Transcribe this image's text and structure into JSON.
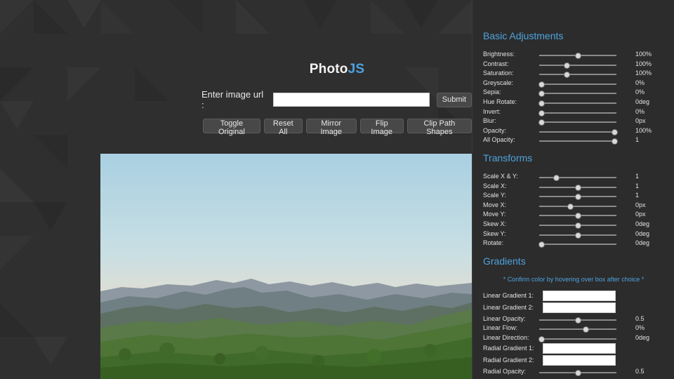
{
  "header": {
    "logo_main": "Photo",
    "logo_accent": "JS"
  },
  "url_form": {
    "label": "Enter image url :",
    "value": "",
    "placeholder": "",
    "submit_label": "Submit"
  },
  "toolbar": {
    "toggle_original": "Toggle Original",
    "reset_all": "Reset All",
    "mirror_image": "Mirror Image",
    "flip_image": "Flip Image",
    "clip_path_shapes": "Clip Path Shapes"
  },
  "panel": {
    "basic": {
      "title": "Basic Adjustments",
      "controls": [
        {
          "label": "Brightness:",
          "value": "100%",
          "level": 0.5
        },
        {
          "label": "Contrast:",
          "value": "100%",
          "level": 0.35
        },
        {
          "label": "Saturation:",
          "value": "100%",
          "level": 0.35
        },
        {
          "label": "Greyscale:",
          "value": "0%",
          "level": 0.03
        },
        {
          "label": "Sepia:",
          "value": "0%",
          "level": 0.03
        },
        {
          "label": "Hue Rotate:",
          "value": "0deg",
          "level": 0.03
        },
        {
          "label": "Invert:",
          "value": "0%",
          "level": 0.03
        },
        {
          "label": "Blur:",
          "value": "0px",
          "level": 0.03
        },
        {
          "label": "Opacity:",
          "value": "100%",
          "level": 0.97
        },
        {
          "label": "All Opacity:",
          "value": "1",
          "level": 0.97
        }
      ]
    },
    "transforms": {
      "title": "Transforms",
      "controls": [
        {
          "label": "Scale X & Y:",
          "value": "1",
          "level": 0.22
        },
        {
          "label": "Scale X:",
          "value": "1",
          "level": 0.5
        },
        {
          "label": "Scale Y:",
          "value": "1",
          "level": 0.5
        },
        {
          "label": "Move X:",
          "value": "0px",
          "level": 0.4
        },
        {
          "label": "Move Y:",
          "value": "0px",
          "level": 0.5
        },
        {
          "label": "Skew X:",
          "value": "0deg",
          "level": 0.5
        },
        {
          "label": "Skew Y:",
          "value": "0deg",
          "level": 0.5
        },
        {
          "label": "Rotate:",
          "value": "0deg",
          "level": 0.03
        }
      ]
    },
    "gradients": {
      "title": "Gradients",
      "note": "* Confirm color by hovering over box after choice *",
      "linear_gradient_1": "Linear Gradient 1:",
      "linear_gradient_2": "Linear Gradient 2:",
      "linear_opacity": {
        "label": "Linear Opacity:",
        "value": "0.5",
        "level": 0.5
      },
      "linear_flow": {
        "label": "Linear Flow:",
        "value": "0%",
        "level": 0.6
      },
      "linear_direction": {
        "label": "Linear Direction:",
        "value": "0deg",
        "level": 0.03
      },
      "radial_gradient_1": "Radial Gradient 1:",
      "radial_gradient_2": "Radial Gradient 2:",
      "radial_opacity": {
        "label": "Radial Opacity:",
        "value": "0.5",
        "level": 0.5
      }
    }
  },
  "colors": {
    "accent": "#4ea3de",
    "panel_bg": "#2c2c2c",
    "page_bg": "#2f2f2f"
  }
}
